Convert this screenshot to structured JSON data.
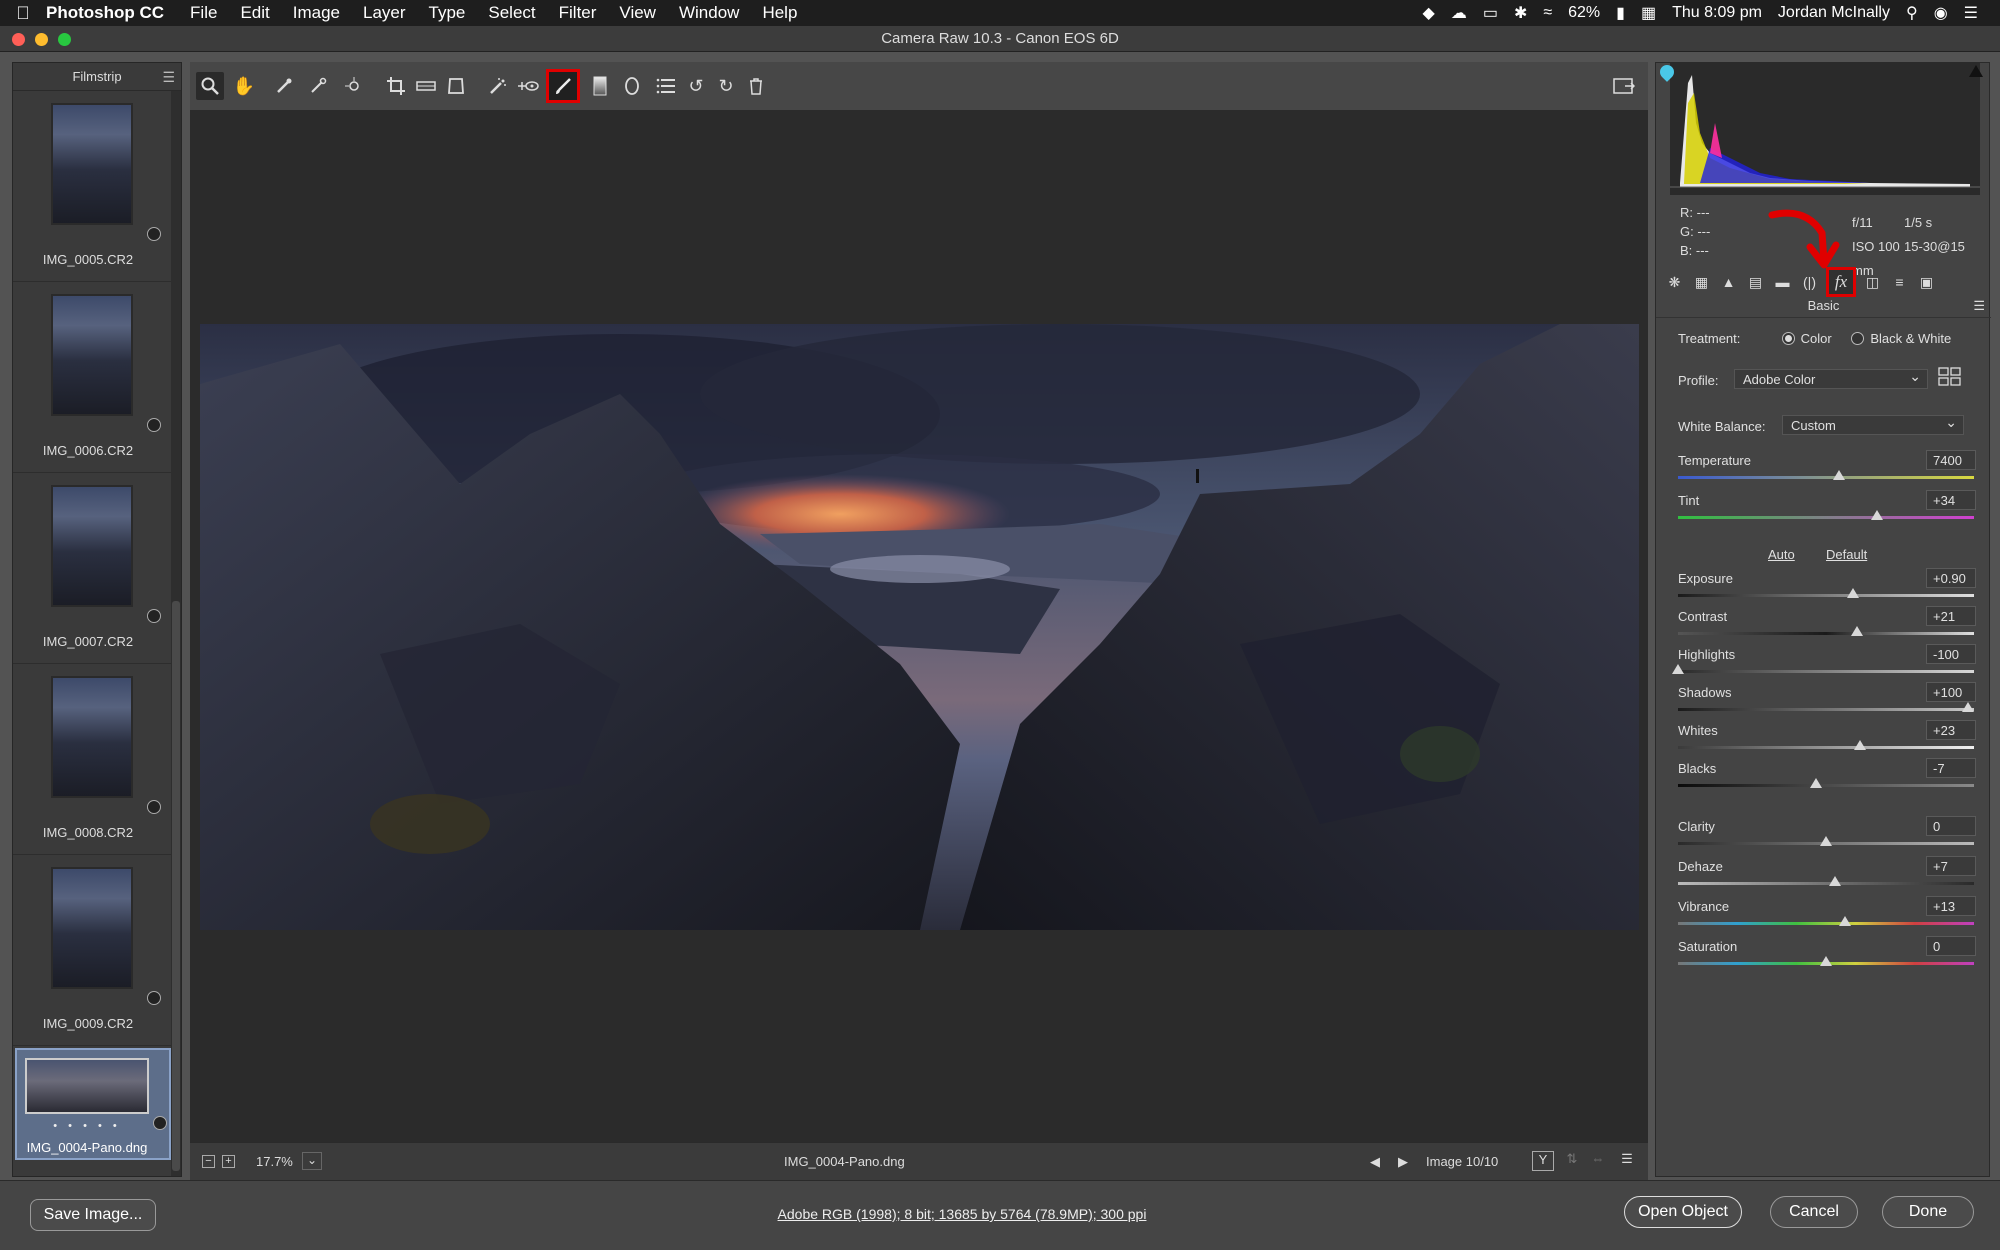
{
  "menubar": {
    "apple": "",
    "app": "Photoshop CC",
    "items": [
      "File",
      "Edit",
      "Image",
      "Layer",
      "Type",
      "Select",
      "Filter",
      "View",
      "Window",
      "Help"
    ],
    "battery": "62%",
    "clock": "Thu 8:09 pm",
    "user": "Jordan McInally"
  },
  "window": {
    "title": "Camera Raw 10.3  -  Canon EOS 6D"
  },
  "filmstrip": {
    "title": "Filmstrip",
    "items": [
      "IMG_0005.CR2",
      "IMG_0006.CR2",
      "IMG_0007.CR2",
      "IMG_0008.CR2",
      "IMG_0009.CR2"
    ],
    "selected": {
      "name": "IMG_0004-Pano.dng",
      "dots": "• • • • •"
    }
  },
  "status": {
    "zoom": "17.7%",
    "filename": "IMG_0004-Pano.dng",
    "image_counter": "Image 10/10"
  },
  "bottom": {
    "save": "Save Image...",
    "info": "Adobe RGB (1998); 8 bit; 13685 by 5764 (78.9MP); 300 ppi",
    "open": "Open Object",
    "cancel": "Cancel",
    "done": "Done"
  },
  "panel": {
    "rgb": {
      "r": "R:   ---",
      "g": "G:   ---",
      "b": "B:   ---"
    },
    "exif": {
      "aperture": "f/11",
      "shutter": "1/5 s",
      "iso": "ISO 100",
      "lens": "15-30@15 mm"
    },
    "title": "Basic",
    "treatment": {
      "label": "Treatment:",
      "color": "Color",
      "bw": "Black & White"
    },
    "profile": {
      "label": "Profile:",
      "value": "Adobe Color"
    },
    "wb": {
      "label": "White Balance:",
      "value": "Custom"
    },
    "auto": "Auto",
    "default": "Default",
    "sliders": [
      {
        "label": "Temperature",
        "value": "7400"
      },
      {
        "label": "Tint",
        "value": "+34"
      },
      {
        "label": "Exposure",
        "value": "+0.90"
      },
      {
        "label": "Contrast",
        "value": "+21"
      },
      {
        "label": "Highlights",
        "value": "-100"
      },
      {
        "label": "Shadows",
        "value": "+100"
      },
      {
        "label": "Whites",
        "value": "+23"
      },
      {
        "label": "Blacks",
        "value": "-7"
      },
      {
        "label": "Clarity",
        "value": "0"
      },
      {
        "label": "Dehaze",
        "value": "+7"
      },
      {
        "label": "Vibrance",
        "value": "+13"
      },
      {
        "label": "Saturation",
        "value": "0"
      }
    ]
  },
  "colors": {
    "highlight": "#e00000",
    "traffic": [
      "#ff5f57",
      "#febc2e",
      "#28c840"
    ]
  },
  "icons": [
    "zoom-icon",
    "hand-icon",
    "white-balance-icon",
    "color-sampler-icon",
    "targeted-adjustment-icon",
    "crop-icon",
    "straighten-icon",
    "transform-icon",
    "spot-removal-icon",
    "red-eye-icon",
    "adjustment-brush-icon",
    "graduated-filter-icon",
    "radial-filter-icon",
    "presets-list-icon",
    "rotate-left-icon",
    "rotate-right-icon",
    "trash-icon",
    "fullscreen-icon"
  ]
}
